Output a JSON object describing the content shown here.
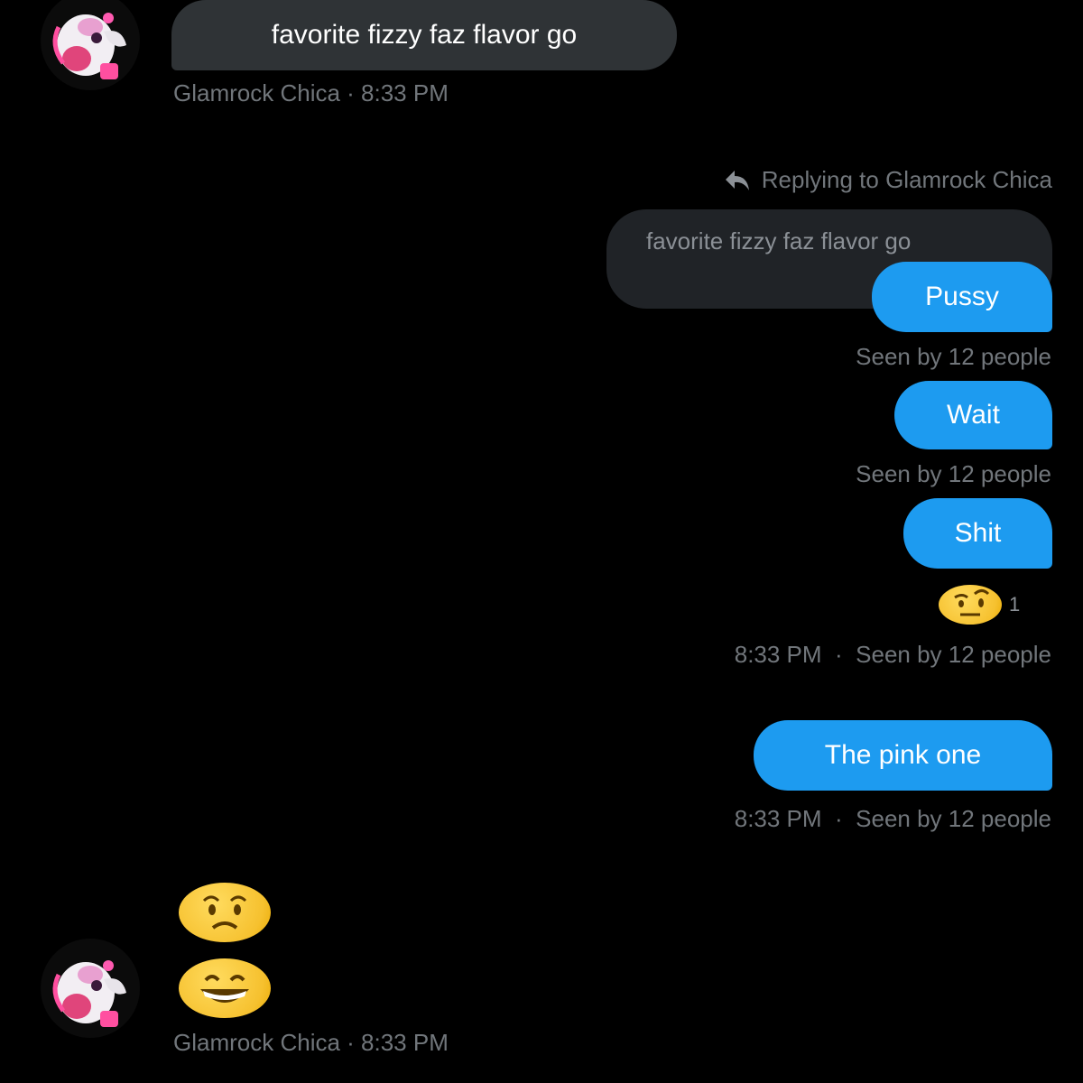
{
  "messages": {
    "first": {
      "text": "favorite fizzy faz flavor go",
      "meta": "Glamrock Chica · 8:33 PM"
    },
    "reply_header": "Replying to Glamrock Chica",
    "quoted_text": "favorite fizzy faz flavor go",
    "sent": [
      {
        "text": "Pussy",
        "meta": "Seen by 12 people"
      },
      {
        "text": "Wait",
        "meta": "Seen by 12 people"
      },
      {
        "text": "Shit",
        "reaction_count": "1",
        "time": "8:33 PM",
        "seen": "Seen by 12 people"
      },
      {
        "text": "The pink one",
        "time": "8:33 PM",
        "seen": "Seen by 12 people"
      }
    ],
    "last_meta": "Glamrock Chica · 8:33 PM"
  },
  "icons": {
    "avatar": "glamrock-chica-avatar",
    "reply": "reply-arrow-icon",
    "reaction": "face-with-raised-eyebrow-emoji",
    "emoji_1": "worried-face-emoji",
    "emoji_2": "grinning-face-emoji"
  },
  "colors": {
    "background": "#000000",
    "incoming_bubble": "#2f3336",
    "outgoing_bubble": "#1d9bf0",
    "meta_text": "#71767b"
  }
}
